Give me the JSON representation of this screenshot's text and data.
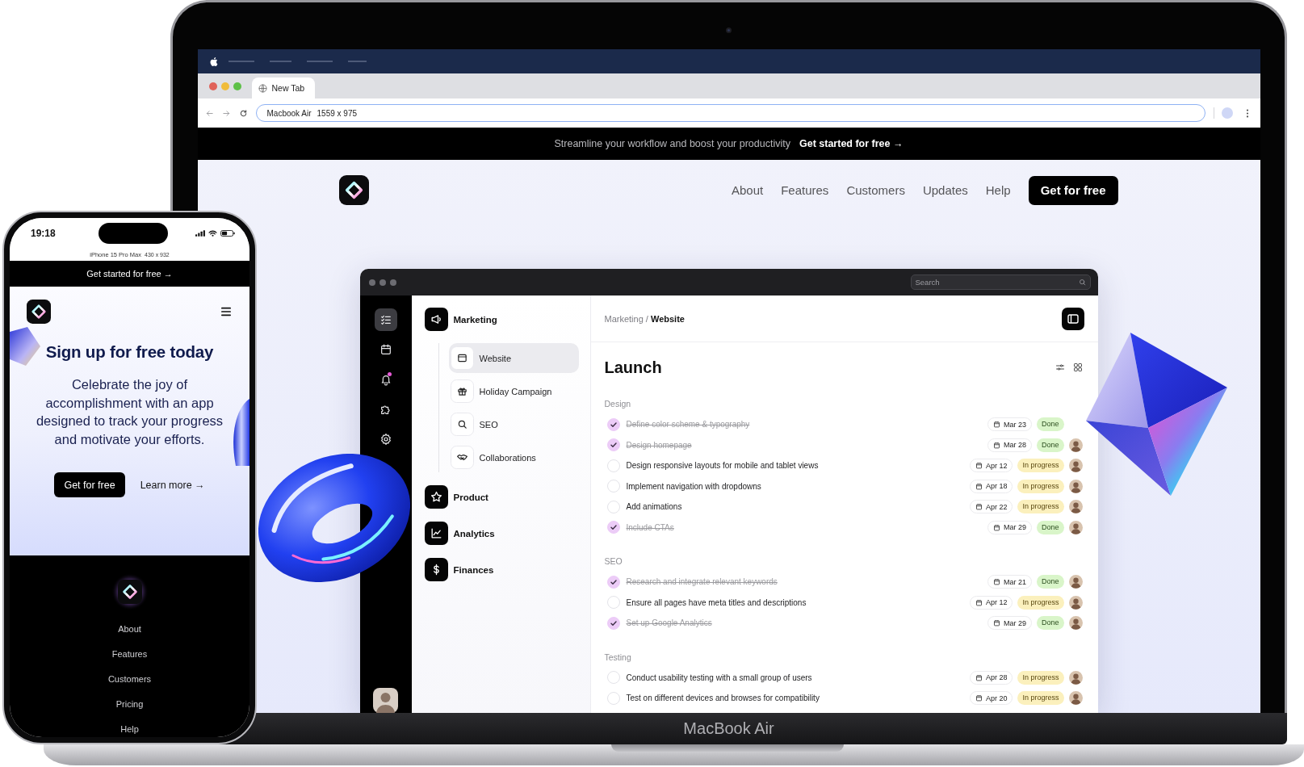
{
  "laptop": {
    "label": "MacBook Air",
    "browser": {
      "tab": {
        "title": "New Tab"
      },
      "address": {
        "device": "Macbook Air",
        "size": "1559 x 975"
      }
    },
    "site": {
      "banner": {
        "text": "Streamline your workflow and boost your productivity",
        "link": "Get started for free →"
      },
      "nav": {
        "links": [
          "About",
          "Features",
          "Customers",
          "Updates",
          "Help"
        ],
        "cta": "Get for free"
      },
      "app": {
        "search": {
          "placeholder": "Search"
        },
        "rail": [
          {
            "selected": true,
            "alert": false
          },
          {
            "selected": false,
            "alert": false
          },
          {
            "selected": false,
            "alert": true
          },
          {
            "selected": false,
            "alert": false
          },
          {
            "selected": false,
            "alert": false
          }
        ],
        "sidebar": [
          {
            "label": "Marketing",
            "children": [
              {
                "label": "Website",
                "selected": true
              },
              {
                "label": "Holiday Campaign",
                "selected": false
              },
              {
                "label": "SEO",
                "selected": false
              },
              {
                "label": "Collaborations",
                "selected": false
              }
            ]
          },
          {
            "label": "Product"
          },
          {
            "label": "Analytics"
          },
          {
            "label": "Finances"
          }
        ],
        "breadcrumb": "Marketing / **Website**",
        "title": "Launch",
        "sections": [
          {
            "label": "Design",
            "tasks": [
              {
                "title": "Define color scheme & typography",
                "checked": true,
                "due": "Mar 23",
                "status": {
                  "label": "Done",
                  "kind": "done"
                },
                "avatar": false
              },
              {
                "title": "Design homepage",
                "checked": true,
                "due": "Mar 28",
                "status": {
                  "label": "Done",
                  "kind": "done"
                },
                "avatar": true
              },
              {
                "title": "Design responsive layouts for mobile and tablet views",
                "checked": false,
                "due": "Apr 12",
                "status": {
                  "label": "In progress",
                  "kind": "in_progress"
                },
                "avatar": true
              },
              {
                "title": "Implement navigation with dropdowns",
                "checked": false,
                "due": "Apr 18",
                "status": {
                  "label": "In progress",
                  "kind": "in_progress"
                },
                "avatar": true
              },
              {
                "title": "Add animations",
                "checked": false,
                "due": "Apr 22",
                "status": {
                  "label": "In progress",
                  "kind": "in_progress"
                },
                "avatar": true
              },
              {
                "title": "Include CTAs",
                "checked": true,
                "due": "Mar 29",
                "status": {
                  "label": "Done",
                  "kind": "done"
                },
                "avatar": true
              }
            ]
          },
          {
            "label": "SEO",
            "tasks": [
              {
                "title": "Research and integrate relevant keywords",
                "checked": true,
                "due": "Mar 21",
                "status": {
                  "label": "Done",
                  "kind": "done"
                },
                "avatar": true
              },
              {
                "title": "Ensure all pages have meta titles and descriptions",
                "checked": false,
                "due": "Apr 12",
                "status": {
                  "label": "In progress",
                  "kind": "in_progress"
                },
                "avatar": true
              },
              {
                "title": "Set up Google Analytics",
                "checked": true,
                "due": "Mar 29",
                "status": {
                  "label": "Done",
                  "kind": "done"
                },
                "avatar": true
              }
            ]
          },
          {
            "label": "Testing",
            "tasks": [
              {
                "title": "Conduct usability testing with a small group of users",
                "checked": false,
                "due": "Apr 28",
                "status": {
                  "label": "In progress",
                  "kind": "in_progress"
                },
                "avatar": true
              },
              {
                "title": "Test on different devices and browses for compatibility",
                "checked": false,
                "due": "Apr 20",
                "status": {
                  "label": "In progress",
                  "kind": "in_progress"
                },
                "avatar": true
              }
            ]
          }
        ]
      }
    }
  },
  "phone": {
    "time": "19:18",
    "device": "iPhone 15 Pro Max",
    "size": "430 x 932",
    "banner": "Get started for free →",
    "headline": "Sign up for free today",
    "body": "Celebrate the joy of accomplishment with an app designed to track your progress and motivate your efforts.",
    "primary": "Get for free",
    "secondary": "Learn more →",
    "footer_links": [
      "About",
      "Features",
      "Customers",
      "Pricing",
      "Help"
    ]
  }
}
